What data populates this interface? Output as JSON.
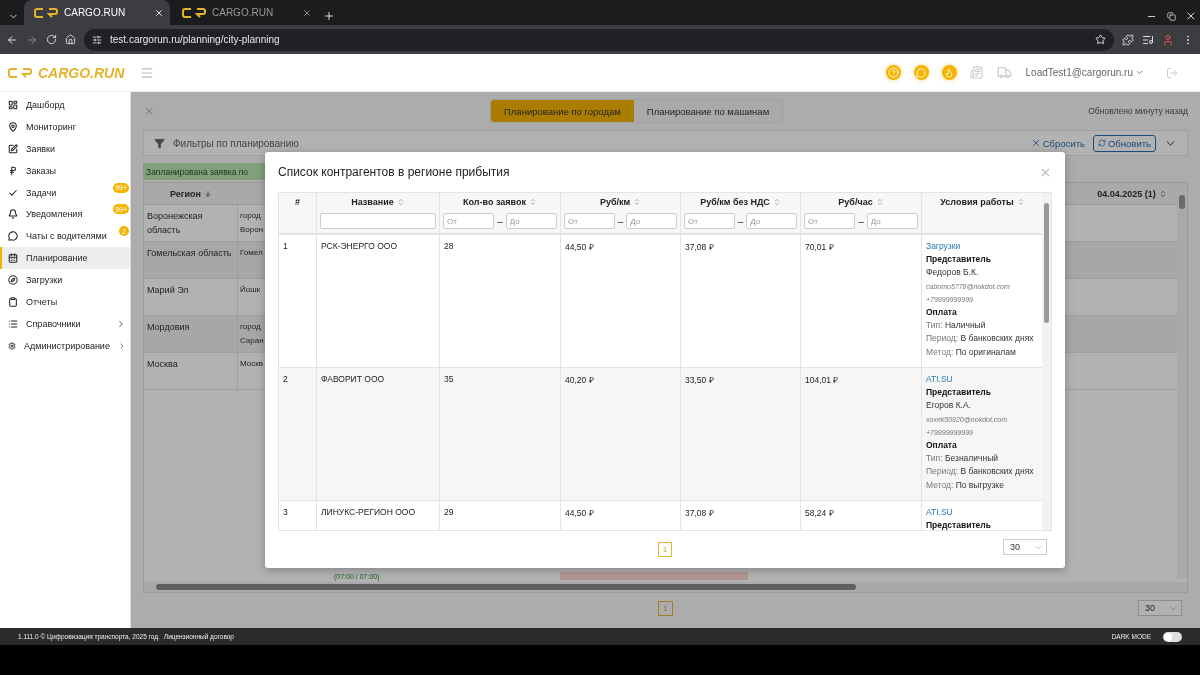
{
  "browser": {
    "tabs": [
      {
        "title": "CARGO.RUN",
        "selected": true
      },
      {
        "title": "CARGO.RUN",
        "selected": false
      }
    ],
    "url": "test.cargorun.ru/planning/city-planning"
  },
  "header": {
    "logo": "CARGO.RUN",
    "user": "LoadTest1@cargorun.ru"
  },
  "sidebar": {
    "items": [
      {
        "label": "Дашборд",
        "selected": false,
        "expandable": false
      },
      {
        "label": "Мониторинг",
        "selected": false,
        "expandable": false
      },
      {
        "label": "Заявки",
        "selected": false,
        "expandable": false
      },
      {
        "label": "Заказы",
        "selected": false,
        "expandable": false
      },
      {
        "label": "Задачи",
        "selected": false,
        "expandable": false,
        "badge": "99+"
      },
      {
        "label": "Уведомления",
        "selected": false,
        "expandable": false,
        "badge": "99+"
      },
      {
        "label": "Чаты с водителями",
        "selected": false,
        "expandable": false,
        "badge": "2"
      },
      {
        "label": "Планирование",
        "selected": true,
        "expandable": false
      },
      {
        "label": "Загрузки",
        "selected": false,
        "expandable": false
      },
      {
        "label": "Отчеты",
        "selected": false,
        "expandable": false
      },
      {
        "label": "Справочники",
        "selected": false,
        "expandable": true
      },
      {
        "label": "Администрирование",
        "selected": false,
        "expandable": true
      }
    ]
  },
  "page": {
    "view_toggle": [
      {
        "label": "Планирование по городам",
        "selected": true
      },
      {
        "label": "Планирование по машинам",
        "selected": false
      }
    ],
    "updated": "Обновлено минуту назад",
    "filters": {
      "title": "Фильтры по планированию",
      "reset": "Сбросить",
      "refresh": "Обновить"
    },
    "banner": "Запланирована заявка по",
    "table": {
      "region_column": "Регион",
      "date_column": "04.04.2025 (1)",
      "rows": [
        {
          "region": "Воронежская область",
          "city_lines": [
            "город",
            "Ворон"
          ]
        },
        {
          "region": "Гомельская область",
          "city_lines": [
            "Гомел"
          ]
        },
        {
          "region": "Марий Эл",
          "city_lines": [
            "Йошк"
          ]
        },
        {
          "region": "Мордовия",
          "city_lines": [
            "город",
            "Саран"
          ]
        },
        {
          "region": "Москва",
          "city_lines": [
            "Москв"
          ]
        }
      ],
      "tail_time": "(07:00 / 07:00)"
    },
    "pagination": {
      "page": "1",
      "page_size": "30"
    }
  },
  "modal": {
    "title": "Список контрагентов в регионе прибытия",
    "columns": [
      {
        "label": "#",
        "sortable": false
      },
      {
        "label": "Название",
        "sortable": true,
        "filter": {
          "kind": "text"
        }
      },
      {
        "label": "Кол-во заявок",
        "sortable": true,
        "filter": {
          "kind": "range",
          "from": {
            "placeholder": "От"
          },
          "separator": "–",
          "to": {
            "placeholder": "До"
          }
        }
      },
      {
        "label": "Руб/км",
        "sortable": true,
        "filter": {
          "kind": "range",
          "from": {
            "placeholder": "От"
          },
          "separator": "–",
          "to": {
            "placeholder": "До"
          }
        }
      },
      {
        "label": "Руб/км без НДС",
        "sortable": true,
        "filter": {
          "kind": "range",
          "from": {
            "placeholder": "От"
          },
          "separator": "–",
          "to": {
            "placeholder": "До"
          }
        }
      },
      {
        "label": "Руб/час",
        "sortable": true,
        "filter": {
          "kind": "range",
          "from": {
            "placeholder": "От"
          },
          "separator": "–",
          "to": {
            "placeholder": "До"
          }
        }
      },
      {
        "label": "Условия работы",
        "sortable": true
      }
    ],
    "rows": [
      {
        "num": "1",
        "name": "РСК-ЭНЕРГО ООО",
        "count": "28",
        "per_km": "44,50 ₽",
        "per_km_no_vat": "37,08 ₽",
        "per_hour": "70,01 ₽",
        "terms": {
          "link": "Загрузки",
          "rep_heading": "Представитель",
          "rep_name": "Федоров Б.К.",
          "email": "cabomo5778@nokdot.com",
          "phone": "+79999999999",
          "pay_heading": "Оплата",
          "payment": [
            {
              "label": "Тип:",
              "value": "Наличный"
            },
            {
              "label": "Период:",
              "value": "В банковских днях"
            },
            {
              "label": "Метод:",
              "value": "По оригиналам"
            }
          ]
        }
      },
      {
        "num": "2",
        "name": "ФАВОРИТ ООО",
        "count": "35",
        "per_km": "40,20 ₽",
        "per_km_no_vat": "33,50 ₽",
        "per_hour": "104,01 ₽",
        "terms": {
          "link": "ATI.SU",
          "rep_heading": "Представитель",
          "rep_name": "Егоров К.А.",
          "email": "xoxek50920@nokdot.com",
          "phone": "+79999999999",
          "pay_heading": "Оплата",
          "payment": [
            {
              "label": "Тип:",
              "value": "Безналичный"
            },
            {
              "label": "Период:",
              "value": "В банковских днях"
            },
            {
              "label": "Метод:",
              "value": "По выгрузке"
            }
          ]
        }
      },
      {
        "num": "3",
        "name": "ЛИНУКС-РЕГИОН ООО",
        "count": "29",
        "per_km": "44,50 ₽",
        "per_km_no_vat": "37,08 ₽",
        "per_hour": "58,24 ₽",
        "terms": {
          "link": "ATI.SU",
          "rep_heading": "Представитель"
        }
      }
    ],
    "pagination": {
      "page": "1",
      "page_size": "30"
    }
  },
  "footer": {
    "version": "1.111.0 © Цифровизация транспорта, 2025 год.",
    "license": "Лицензионный договор",
    "dark_mode": {
      "label": "DARK MODE",
      "on": false
    }
  }
}
